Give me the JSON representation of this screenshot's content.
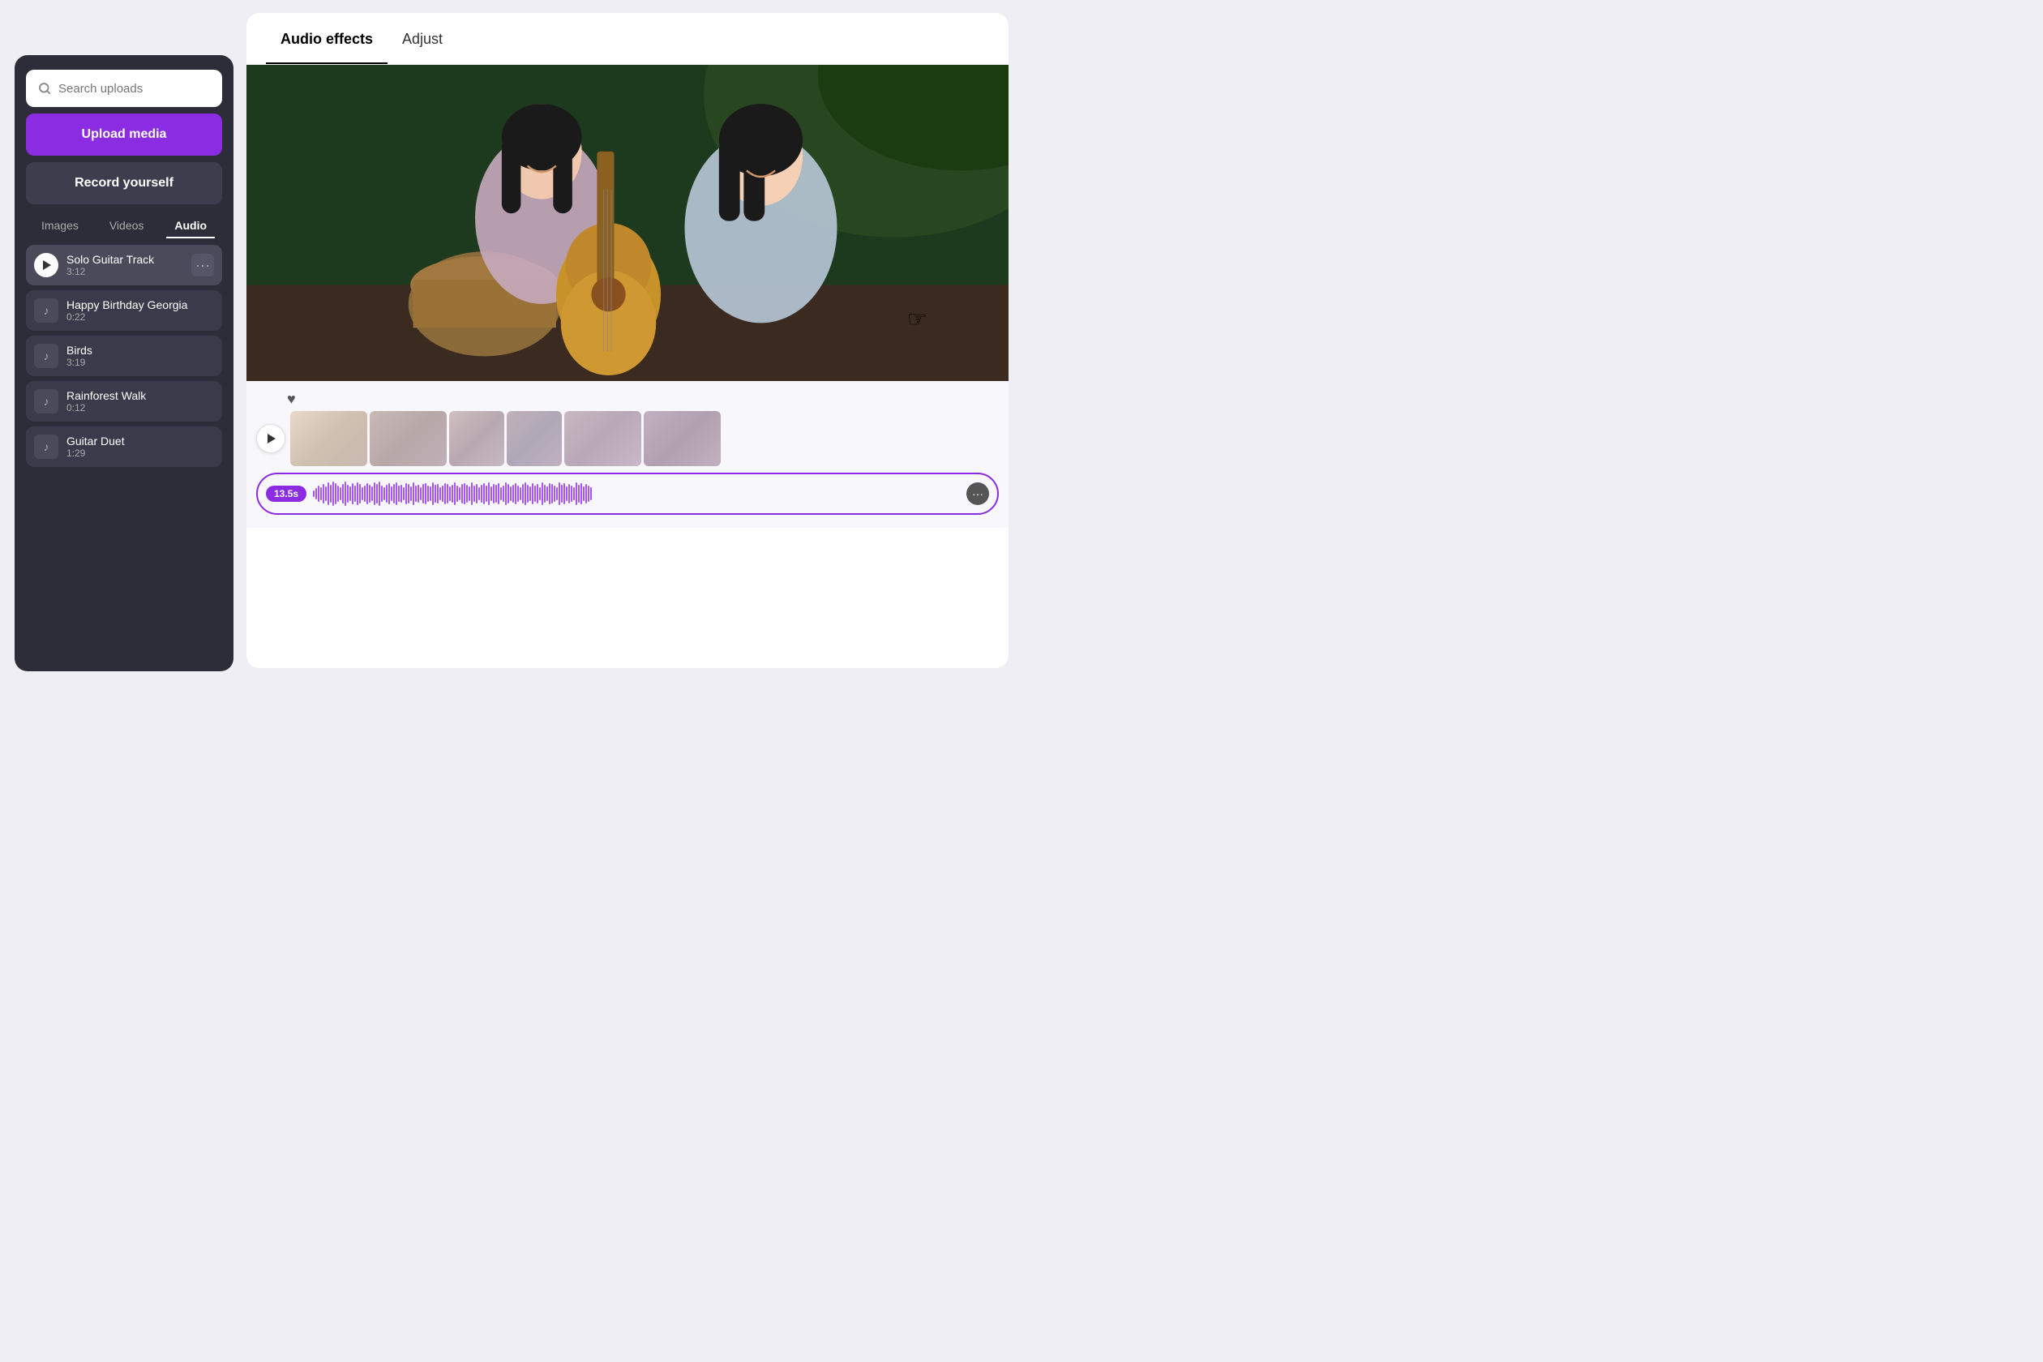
{
  "left_panel": {
    "search": {
      "placeholder": "Search uploads"
    },
    "upload_btn": "Upload media",
    "record_btn": "Record yourself",
    "tabs": [
      {
        "id": "images",
        "label": "Images",
        "active": false
      },
      {
        "id": "videos",
        "label": "Videos",
        "active": false
      },
      {
        "id": "audio",
        "label": "Audio",
        "active": true
      }
    ],
    "audio_items": [
      {
        "id": 1,
        "name": "Solo Guitar Track",
        "duration": "3:12",
        "playing": true
      },
      {
        "id": 2,
        "name": "Happy Birthday Georgia",
        "duration": "0:22",
        "playing": false
      },
      {
        "id": 3,
        "name": "Birds",
        "duration": "3:19",
        "playing": false
      },
      {
        "id": 4,
        "name": "Rainforest Walk",
        "duration": "0:12",
        "playing": false
      },
      {
        "id": 5,
        "name": "Guitar Duet",
        "duration": "1:29",
        "playing": false
      }
    ]
  },
  "right_panel": {
    "tabs": [
      {
        "id": "audio-effects",
        "label": "Audio effects",
        "active": true
      },
      {
        "id": "adjust",
        "label": "Adjust",
        "active": false
      }
    ],
    "timeline": {
      "time_badge": "13.5s",
      "more_btn_label": "···"
    }
  }
}
